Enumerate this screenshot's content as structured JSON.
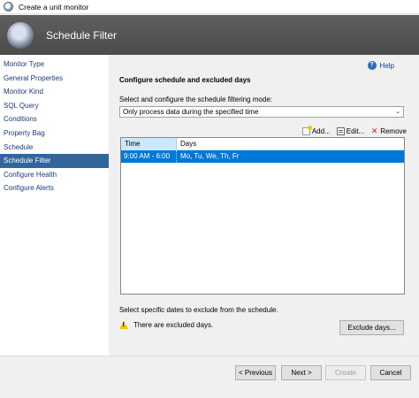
{
  "window": {
    "title": "Create a unit monitor"
  },
  "header": {
    "title": "Schedule Filter"
  },
  "nav": {
    "items": [
      {
        "label": "Monitor Type",
        "active": false
      },
      {
        "label": "General Properties",
        "active": false
      },
      {
        "label": "Monitor Kind",
        "active": false
      },
      {
        "label": "SQL Query",
        "active": false
      },
      {
        "label": "Conditions",
        "active": false
      },
      {
        "label": "Property Bag",
        "active": false
      },
      {
        "label": "Schedule",
        "active": false
      },
      {
        "label": "Schedule Filter",
        "active": true
      },
      {
        "label": "Configure Health",
        "active": false
      },
      {
        "label": "Configure Alerts",
        "active": false
      }
    ]
  },
  "main": {
    "help_label": "Help",
    "section_title": "Configure schedule and excluded days",
    "mode_label": "Select and configure the schedule filtering mode:",
    "mode_value": "Only process data during the specified time",
    "toolbar": {
      "add": "Add...",
      "edit": "Edit...",
      "remove": "Remove"
    },
    "grid": {
      "columns": [
        "Time",
        "Days"
      ],
      "rows": [
        {
          "time": "9:00 AM - 6:00 PM",
          "days": "Mo, Tu, We, Th, Fr"
        }
      ]
    },
    "exclude_label": "Select specific dates to exclude from the schedule.",
    "warning_text": "There are excluded days.",
    "exclude_button": "Exclude days..."
  },
  "footer": {
    "previous": "< Previous",
    "next": "Next >",
    "create": "Create",
    "cancel": "Cancel"
  },
  "colors": {
    "accent": "#0078d7",
    "nav_active": "#31669c",
    "header_bg": "#545454"
  }
}
